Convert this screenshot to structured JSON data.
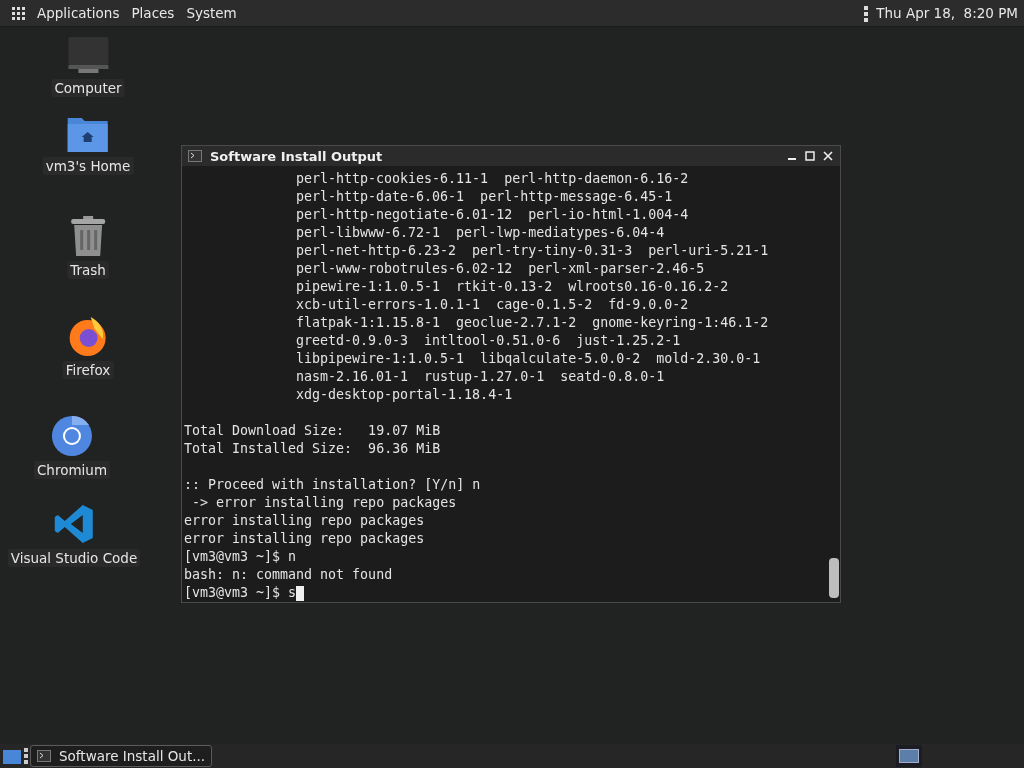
{
  "top_panel": {
    "menus": [
      "Applications",
      "Places",
      "System"
    ],
    "clock": "Thu Apr 18,  8:20 PM"
  },
  "desktop_icons": [
    {
      "kind": "computer",
      "label": "Computer"
    },
    {
      "kind": "home",
      "label": "vm3's Home"
    },
    {
      "kind": "trash",
      "label": "Trash"
    },
    {
      "kind": "firefox",
      "label": "Firefox"
    },
    {
      "kind": "chromium",
      "label": "Chromium"
    },
    {
      "kind": "vscode",
      "label": "Visual Studio Code"
    }
  ],
  "terminal": {
    "title": "Software Install Output",
    "lines": [
      {
        "kind": "package",
        "text": "perl-http-cookies-6.11-1  perl-http-daemon-6.16-2"
      },
      {
        "kind": "package",
        "text": "perl-http-date-6.06-1  perl-http-message-6.45-1"
      },
      {
        "kind": "package",
        "text": "perl-http-negotiate-6.01-12  perl-io-html-1.004-4"
      },
      {
        "kind": "package",
        "text": "perl-libwww-6.72-1  perl-lwp-mediatypes-6.04-4"
      },
      {
        "kind": "package",
        "text": "perl-net-http-6.23-2  perl-try-tiny-0.31-3  perl-uri-5.21-1"
      },
      {
        "kind": "package",
        "text": "perl-www-robotrules-6.02-12  perl-xml-parser-2.46-5"
      },
      {
        "kind": "package",
        "text": "pipewire-1:1.0.5-1  rtkit-0.13-2  wlroots0.16-0.16.2-2"
      },
      {
        "kind": "package",
        "text": "xcb-util-errors-1.0.1-1  cage-0.1.5-2  fd-9.0.0-2"
      },
      {
        "kind": "package",
        "text": "flatpak-1:1.15.8-1  geoclue-2.7.1-2  gnome-keyring-1:46.1-2"
      },
      {
        "kind": "package",
        "text": "greetd-0.9.0-3  intltool-0.51.0-6  just-1.25.2-1"
      },
      {
        "kind": "package",
        "text": "libpipewire-1:1.0.5-1  libqalculate-5.0.0-2  mold-2.30.0-1"
      },
      {
        "kind": "package",
        "text": "nasm-2.16.01-1  rustup-1.27.0-1  seatd-0.8.0-1"
      },
      {
        "kind": "package",
        "text": "xdg-desktop-portal-1.18.4-1"
      },
      {
        "kind": "blank"
      },
      {
        "kind": "text",
        "text": "Total Download Size:   19.07 MiB"
      },
      {
        "kind": "text",
        "text": "Total Installed Size:  96.36 MiB"
      },
      {
        "kind": "blank"
      },
      {
        "kind": "text",
        "text": ":: Proceed with installation? [Y/n] n"
      },
      {
        "kind": "text",
        "text": " -> error installing repo packages"
      },
      {
        "kind": "text",
        "text": "error installing repo packages"
      },
      {
        "kind": "text",
        "text": "error installing repo packages"
      },
      {
        "kind": "text",
        "text": "[vm3@vm3 ~]$ n"
      },
      {
        "kind": "text",
        "text": "bash: n: command not found"
      },
      {
        "kind": "prompt",
        "text": "[vm3@vm3 ~]$ s"
      }
    ]
  },
  "taskbar": {
    "tasks": [
      {
        "label": "Software Install Out...",
        "selected": true
      }
    ]
  }
}
